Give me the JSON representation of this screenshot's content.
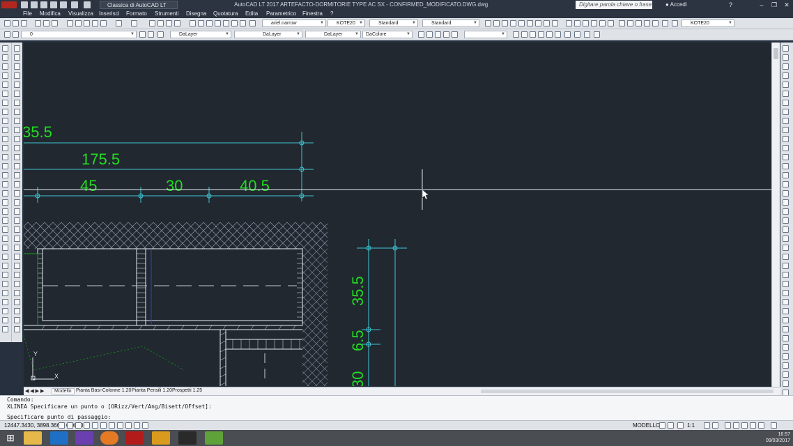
{
  "titlebar": {
    "workspace": "Classica di AutoCAD LT",
    "window_title": "AutoCAD LT 2017    ARTEFACTO-DORMITORIE TYPE AC SX - CONFIRMED_MODIFICATO.DWG.dwg",
    "search_placeholder": "Digitare parola chiave o frase",
    "signin": "Accedi",
    "help": "?"
  },
  "menu": [
    "File",
    "Modifica",
    "Visualizza",
    "Inserisci",
    "Formato",
    "Strumenti",
    "Disegna",
    "Quotatura",
    "Edita",
    "Parametrico",
    "Finestra",
    "?"
  ],
  "toolbar_styles": {
    "text_font": "ariel.narrow",
    "text_style": "KOTE20",
    "dim_style": "Standard",
    "table_style": "Standard",
    "mleader_style": "KOTE20"
  },
  "toolbar_props": {
    "layer": "0",
    "color": "DaLayer",
    "linetype": "DaLayer",
    "lineweight": "DaLayer",
    "plotstyle": "DaColore"
  },
  "drawing": {
    "dims_top": [
      "35.5",
      "175.5",
      "45",
      "30",
      "40.5"
    ],
    "dims_right": [
      "35.5",
      "6.5",
      "30"
    ],
    "ucs_y": "Y",
    "ucs_x": "X"
  },
  "layout_tabs": [
    "Modello",
    "Pianta Basi-Colonne 1.20",
    "Pianta Pensili 1.20",
    "Prospetti 1.25"
  ],
  "command_lines": [
    "Comando:",
    "XLINEA Specificare un punto o [ORizz/Vert/Ang/Bisett/OFfset]:",
    "Specificare punto di passaggio:"
  ],
  "status": {
    "coords": "12447.3430, 3898.3663, 0.0000",
    "mode": "MODELLO",
    "scale": "1:1"
  },
  "clock": {
    "time": "16:57",
    "date": "09/03/2017"
  },
  "colors": {
    "canvas": "#212830",
    "dim_text": "#22dd22",
    "dim_line": "#3ec8d4"
  }
}
